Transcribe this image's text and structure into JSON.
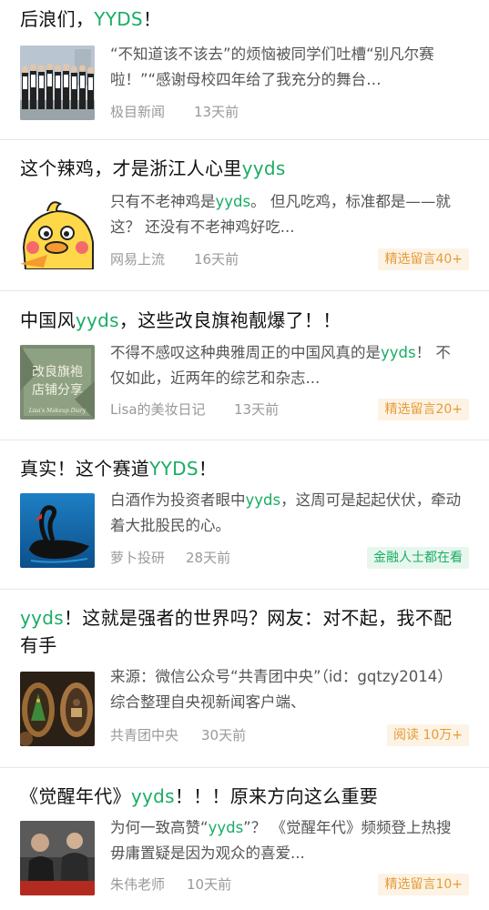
{
  "articles": [
    {
      "title_pre": "后浪们，",
      "title_hl": "YYDS",
      "title_post": "！",
      "summary_pre": "“不知道该不该去”的烦恼被同学们吐槽“别凡尔赛啦！”“感谢母校四年给了我充分的舞台…",
      "summary_hl": "",
      "summary_post": "",
      "source": "极目新闻",
      "time": "13天前",
      "badge": "",
      "badge_style": "",
      "thumb_icon": "graduates-photo"
    },
    {
      "title_pre": "这个辣鸡，才是浙江人心里",
      "title_hl": "yyds",
      "title_post": "",
      "summary_pre": "只有不老神鸡是",
      "summary_hl": "yyds",
      "summary_post": "。 但凡吃鸡，标准都是——就这？ 还没有不老神鸡好吃...",
      "source": "网易上流",
      "time": "16天前",
      "badge": "精选留言40+",
      "badge_style": "orange",
      "thumb_icon": "cartoon-chick"
    },
    {
      "title_pre": "中国风",
      "title_hl": "yyds",
      "title_post": "，这些改良旗袍靓爆了！！",
      "summary_pre": "不得不感叹这种典雅周正的中国风真的是",
      "summary_hl": "yyds",
      "summary_post": "！ 不仅如此，近两年的综艺和杂志...",
      "source": "Lisa的美妆日记",
      "time": "13天前",
      "badge": "精选留言20+",
      "badge_style": "orange",
      "thumb_icon": "qipao-shop-sign",
      "thumb_text_1": "改良旗袍",
      "thumb_text_2": "店铺分享",
      "thumb_text_3": "Lisa's Makeup Diary"
    },
    {
      "title_pre": "真实！这个赛道",
      "title_hl": "YYDS",
      "title_post": "！",
      "summary_pre": "白酒作为投资者眼中",
      "summary_hl": "yyds",
      "summary_post": "，这周可是起起伏伏，牵动着大批股民的心。",
      "source": "萝卜投研",
      "time": "28天前",
      "badge": "金融人士都在看",
      "badge_style": "green",
      "thumb_icon": "black-swan"
    },
    {
      "title_pre": "",
      "title_hl": "yyds",
      "title_post": "！这就是强者的世界吗？网友：对不起，我不配有手",
      "summary_pre": "来源：微信公众号“共青团中央”（id：gqtzy2014）综合整理自央视新闻客户端、",
      "summary_hl": "",
      "summary_post": "",
      "source": "共青团中央",
      "time": "30天前",
      "badge": "阅读 10万+",
      "badge_style": "orange",
      "thumb_icon": "walnut-carving"
    },
    {
      "title_pre": "《觉醒年代》",
      "title_hl": "yyds",
      "title_post": "！！！原来方向这么重要",
      "summary_pre": "为何一致高赞“",
      "summary_hl": "yyds",
      "summary_post": "”？ 《觉醒年代》频频登上热搜毋庸置疑是因为观众的喜爱...",
      "source": "朱伟老师",
      "time": "10天前",
      "badge": "精选留言10+",
      "badge_style": "orange",
      "thumb_icon": "drama-still"
    }
  ],
  "colors": {
    "accent": "#1aad64",
    "badge_orange_text": "#e59b38",
    "badge_orange_bg": "#fdf3e4",
    "badge_green_bg": "#e8f7ee",
    "meta_text": "#999999",
    "summary_text": "#555555"
  }
}
